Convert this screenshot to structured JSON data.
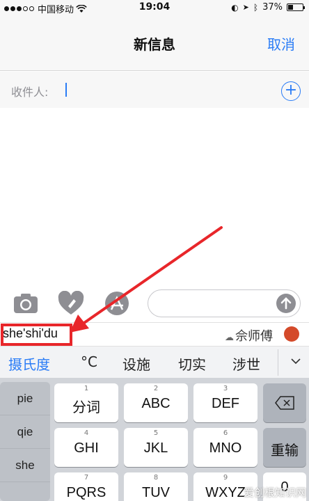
{
  "status_bar": {
    "carrier": "中国移动",
    "time": "19:04",
    "battery_percent": "37%",
    "battery_level": 0.37
  },
  "nav": {
    "title": "新信息",
    "cancel": "取消"
  },
  "recipient": {
    "label": "收件人:",
    "add_icon": "plus-circle-icon"
  },
  "toolbar": {
    "icons": [
      "camera-icon",
      "heart-touch-icon",
      "app-store-icon",
      "send-arrow-icon"
    ],
    "message_placeholder": ""
  },
  "ime": {
    "pinyin": "she'shi'du",
    "cloud_suggestion": "佘师傅",
    "candidates": [
      "摄氏度",
      "°C",
      "设施",
      "切实",
      "涉世"
    ],
    "side_list": [
      "pie",
      "qie",
      "she"
    ],
    "keys": [
      {
        "num": "1",
        "label": "分词"
      },
      {
        "num": "2",
        "label": "ABC"
      },
      {
        "num": "3",
        "label": "DEF"
      },
      {
        "num": "4",
        "label": "GHI"
      },
      {
        "num": "5",
        "label": "JKL"
      },
      {
        "num": "6",
        "label": "MNO"
      },
      {
        "num": "7",
        "label": "PQRS"
      },
      {
        "num": "8",
        "label": "TUV"
      },
      {
        "num": "9",
        "label": "WXYZ"
      }
    ],
    "reenter": "重输",
    "zero": "0"
  },
  "colors": {
    "accent": "#2a7cf6",
    "annotation": "#e8262a"
  },
  "watermark": "爱创根知识网"
}
